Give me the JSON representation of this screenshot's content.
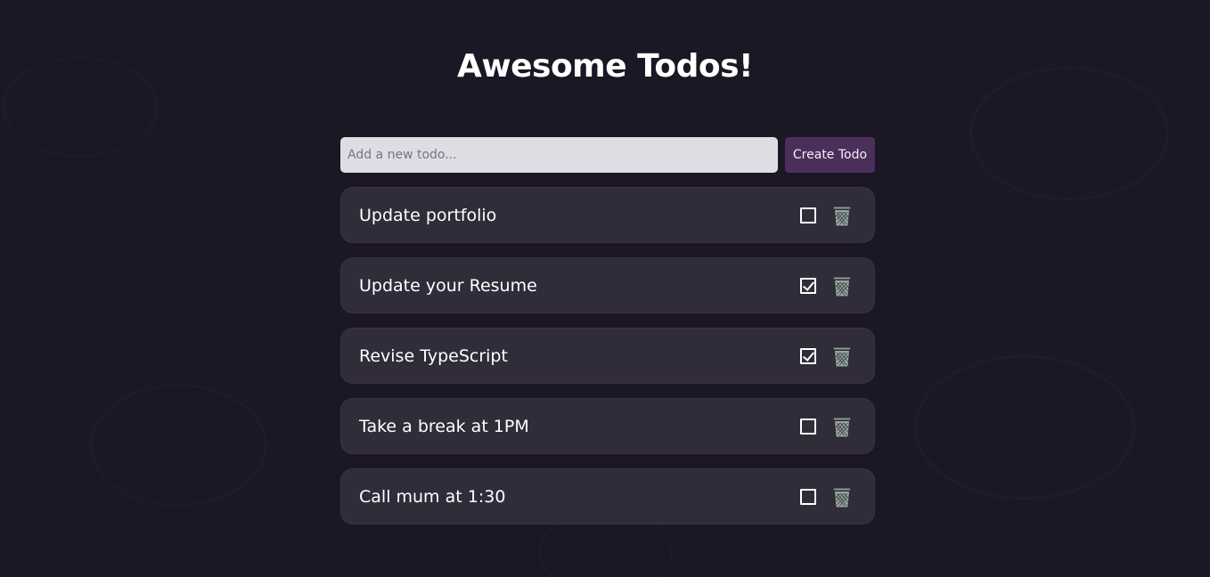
{
  "header": {
    "title": "Awesome Todos!"
  },
  "form": {
    "input_value": "",
    "input_placeholder": "Add a new todo...",
    "create_label": "Create Todo"
  },
  "todos": [
    {
      "text": "Update portfolio",
      "done": false,
      "icon": "trash-icon"
    },
    {
      "text": "Update your Resume",
      "done": true,
      "icon": "trash-icon"
    },
    {
      "text": "Revise TypeScript",
      "done": true,
      "icon": "trash-icon"
    },
    {
      "text": "Take a break at 1PM",
      "done": false,
      "icon": "trash-icon"
    },
    {
      "text": "Call mum at 1:30",
      "done": false,
      "icon": "trash-icon"
    }
  ],
  "colors": {
    "background": "#1b1724",
    "card": "#312c39",
    "accent": "#4b2f5b",
    "input": "#dedde3"
  }
}
